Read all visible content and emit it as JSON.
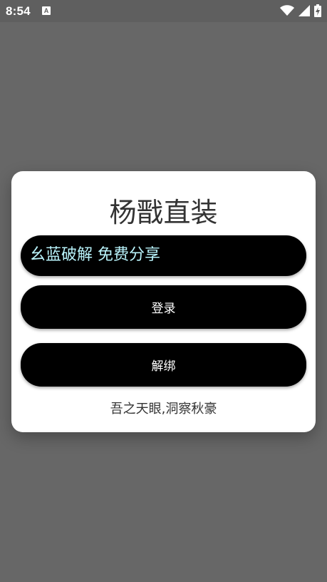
{
  "status_bar": {
    "time": "8:54",
    "notification_icon": "A"
  },
  "dialog": {
    "title": "杨戬直装",
    "banner_text": "幺蓝破解 免费分享",
    "login_label": "登录",
    "unbind_label": "解绑",
    "footer": "吾之天眼,洞察秋豪"
  },
  "colors": {
    "backdrop": "#676767",
    "dialog_bg": "#ffffff",
    "button_bg": "#000000",
    "banner_text": "#b9f3fb"
  }
}
